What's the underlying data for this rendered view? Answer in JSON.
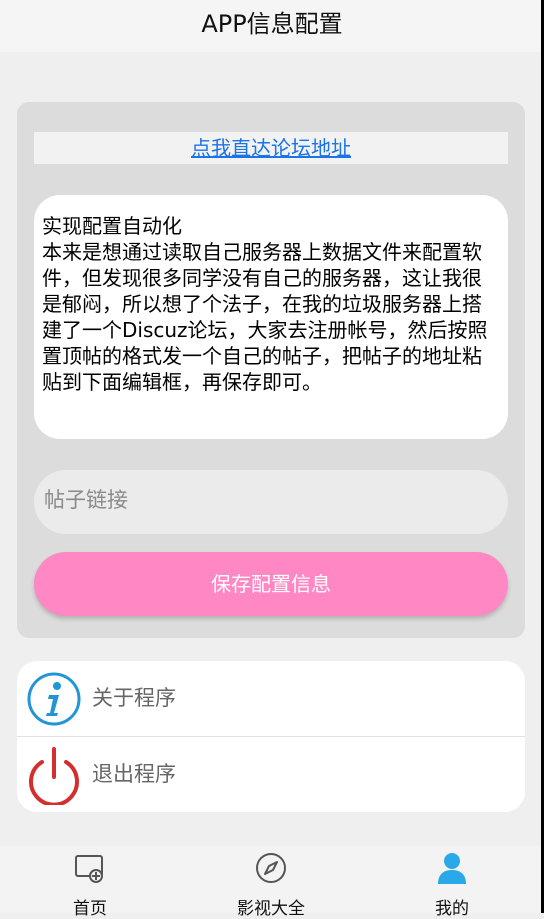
{
  "header": {
    "title": "APP信息配置"
  },
  "config_card": {
    "forum_link_text": "点我直达论坛地址",
    "description_title": "实现配置自动化",
    "description_body": "本来是想通过读取自己服务器上数据文件来配置软件，但发现很多同学没有自己的服务器，这让我很是郁闷，所以想了个法子，在我的垃圾服务器上搭建了一个Discuz论坛，大家去注册帐号，然后按照置顶帖的格式发一个自己的帖子，把帖子的地址粘贴到下面编辑框，再保存即可。",
    "post_link_placeholder": "帖子链接",
    "post_link_value": "",
    "save_label": "保存配置信息"
  },
  "menu": {
    "items": [
      {
        "label": "关于程序",
        "icon": "info-icon"
      },
      {
        "label": "退出程序",
        "icon": "power-icon"
      }
    ]
  },
  "tabbar": {
    "tabs": [
      {
        "label": "首页",
        "icon": "home-screen-icon",
        "active": false
      },
      {
        "label": "影视大全",
        "icon": "compass-icon",
        "active": false
      },
      {
        "label": "我的",
        "icon": "user-icon",
        "active": true
      }
    ]
  },
  "colors": {
    "accent_pink": "#ff87c4",
    "link_blue": "#1a73e8",
    "info_blue": "#2196d6",
    "power_red": "#d32f2f",
    "active_tab": "#29a9e8"
  }
}
